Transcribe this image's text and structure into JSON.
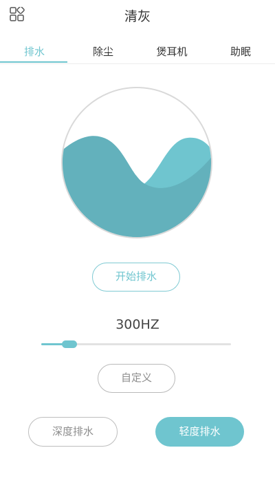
{
  "header": {
    "title": "清灰",
    "menu_icon": "apps-grid-icon"
  },
  "tabs": [
    {
      "label": "排水",
      "active": true
    },
    {
      "label": "除尘",
      "active": false
    },
    {
      "label": "煲耳机",
      "active": false
    },
    {
      "label": "助眠",
      "active": false
    }
  ],
  "colors": {
    "accent": "#6fc5cf",
    "wave_back": "#6fc5cf",
    "wave_front": "#63b1bc"
  },
  "actions": {
    "start_label": "开始排水",
    "custom_label": "自定义"
  },
  "frequency": {
    "value_label": "300HZ",
    "slider_fraction": 0.15
  },
  "modes": {
    "deep_label": "深度排水",
    "light_label": "轻度排水",
    "selected": "light"
  }
}
